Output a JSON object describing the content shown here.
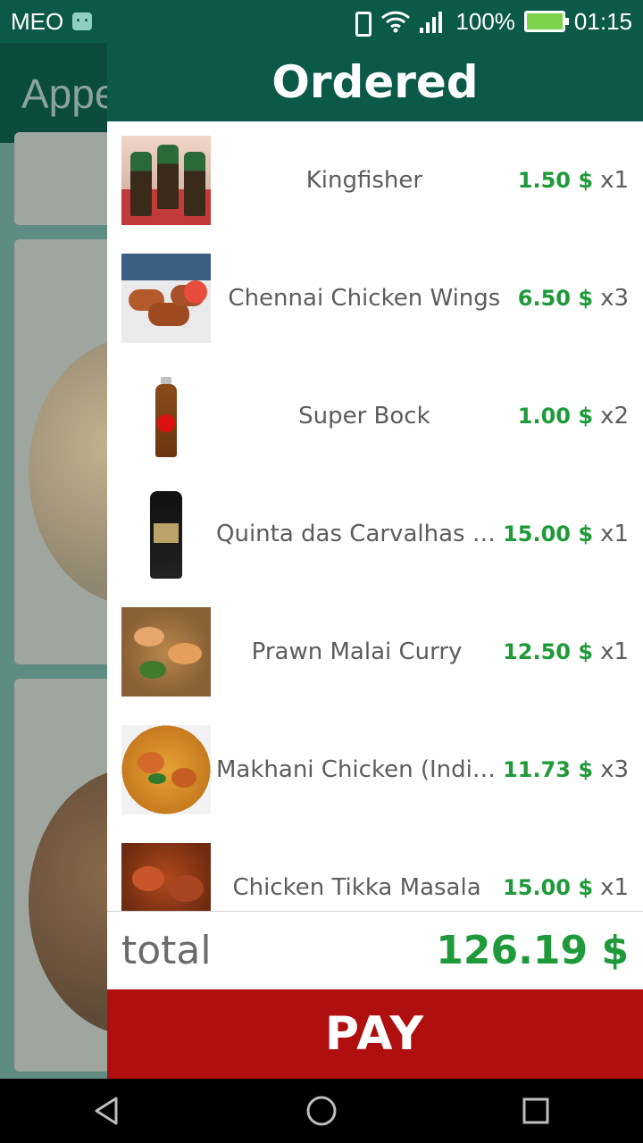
{
  "status": {
    "carrier": "MEO",
    "battery": "100%",
    "time": "01:15"
  },
  "background": {
    "title": "Appet"
  },
  "dialog": {
    "title": "Ordered",
    "items": [
      {
        "name": "Kingfisher",
        "price": "1.50 $",
        "qty": "x1"
      },
      {
        "name": "Chennai Chicken Wings",
        "price": "6.50 $",
        "qty": "x3"
      },
      {
        "name": "Super Bock",
        "price": "1.00 $",
        "qty": "x2"
      },
      {
        "name": "Quinta das Carvalhas Late-Bo…",
        "price": "15.00 $",
        "qty": "x1"
      },
      {
        "name": "Prawn Malai Curry",
        "price": "12.50 $",
        "qty": "x1"
      },
      {
        "name": "Makhani Chicken (Indian Butte…",
        "price": "11.73 $",
        "qty": "x3"
      },
      {
        "name": "Chicken Tikka Masala",
        "price": "15.00 $",
        "qty": "x1"
      }
    ],
    "total_label": "total",
    "total_value": "126.19 $",
    "pay_label": "PAY"
  },
  "colors": {
    "header": "#0b5a49",
    "price": "#1f9a3a",
    "pay": "#b00f10"
  },
  "icons": [
    "android-icon",
    "vibrate-icon",
    "wifi-icon",
    "signal-icon",
    "battery-icon",
    "back-icon",
    "home-icon",
    "recents-icon"
  ]
}
